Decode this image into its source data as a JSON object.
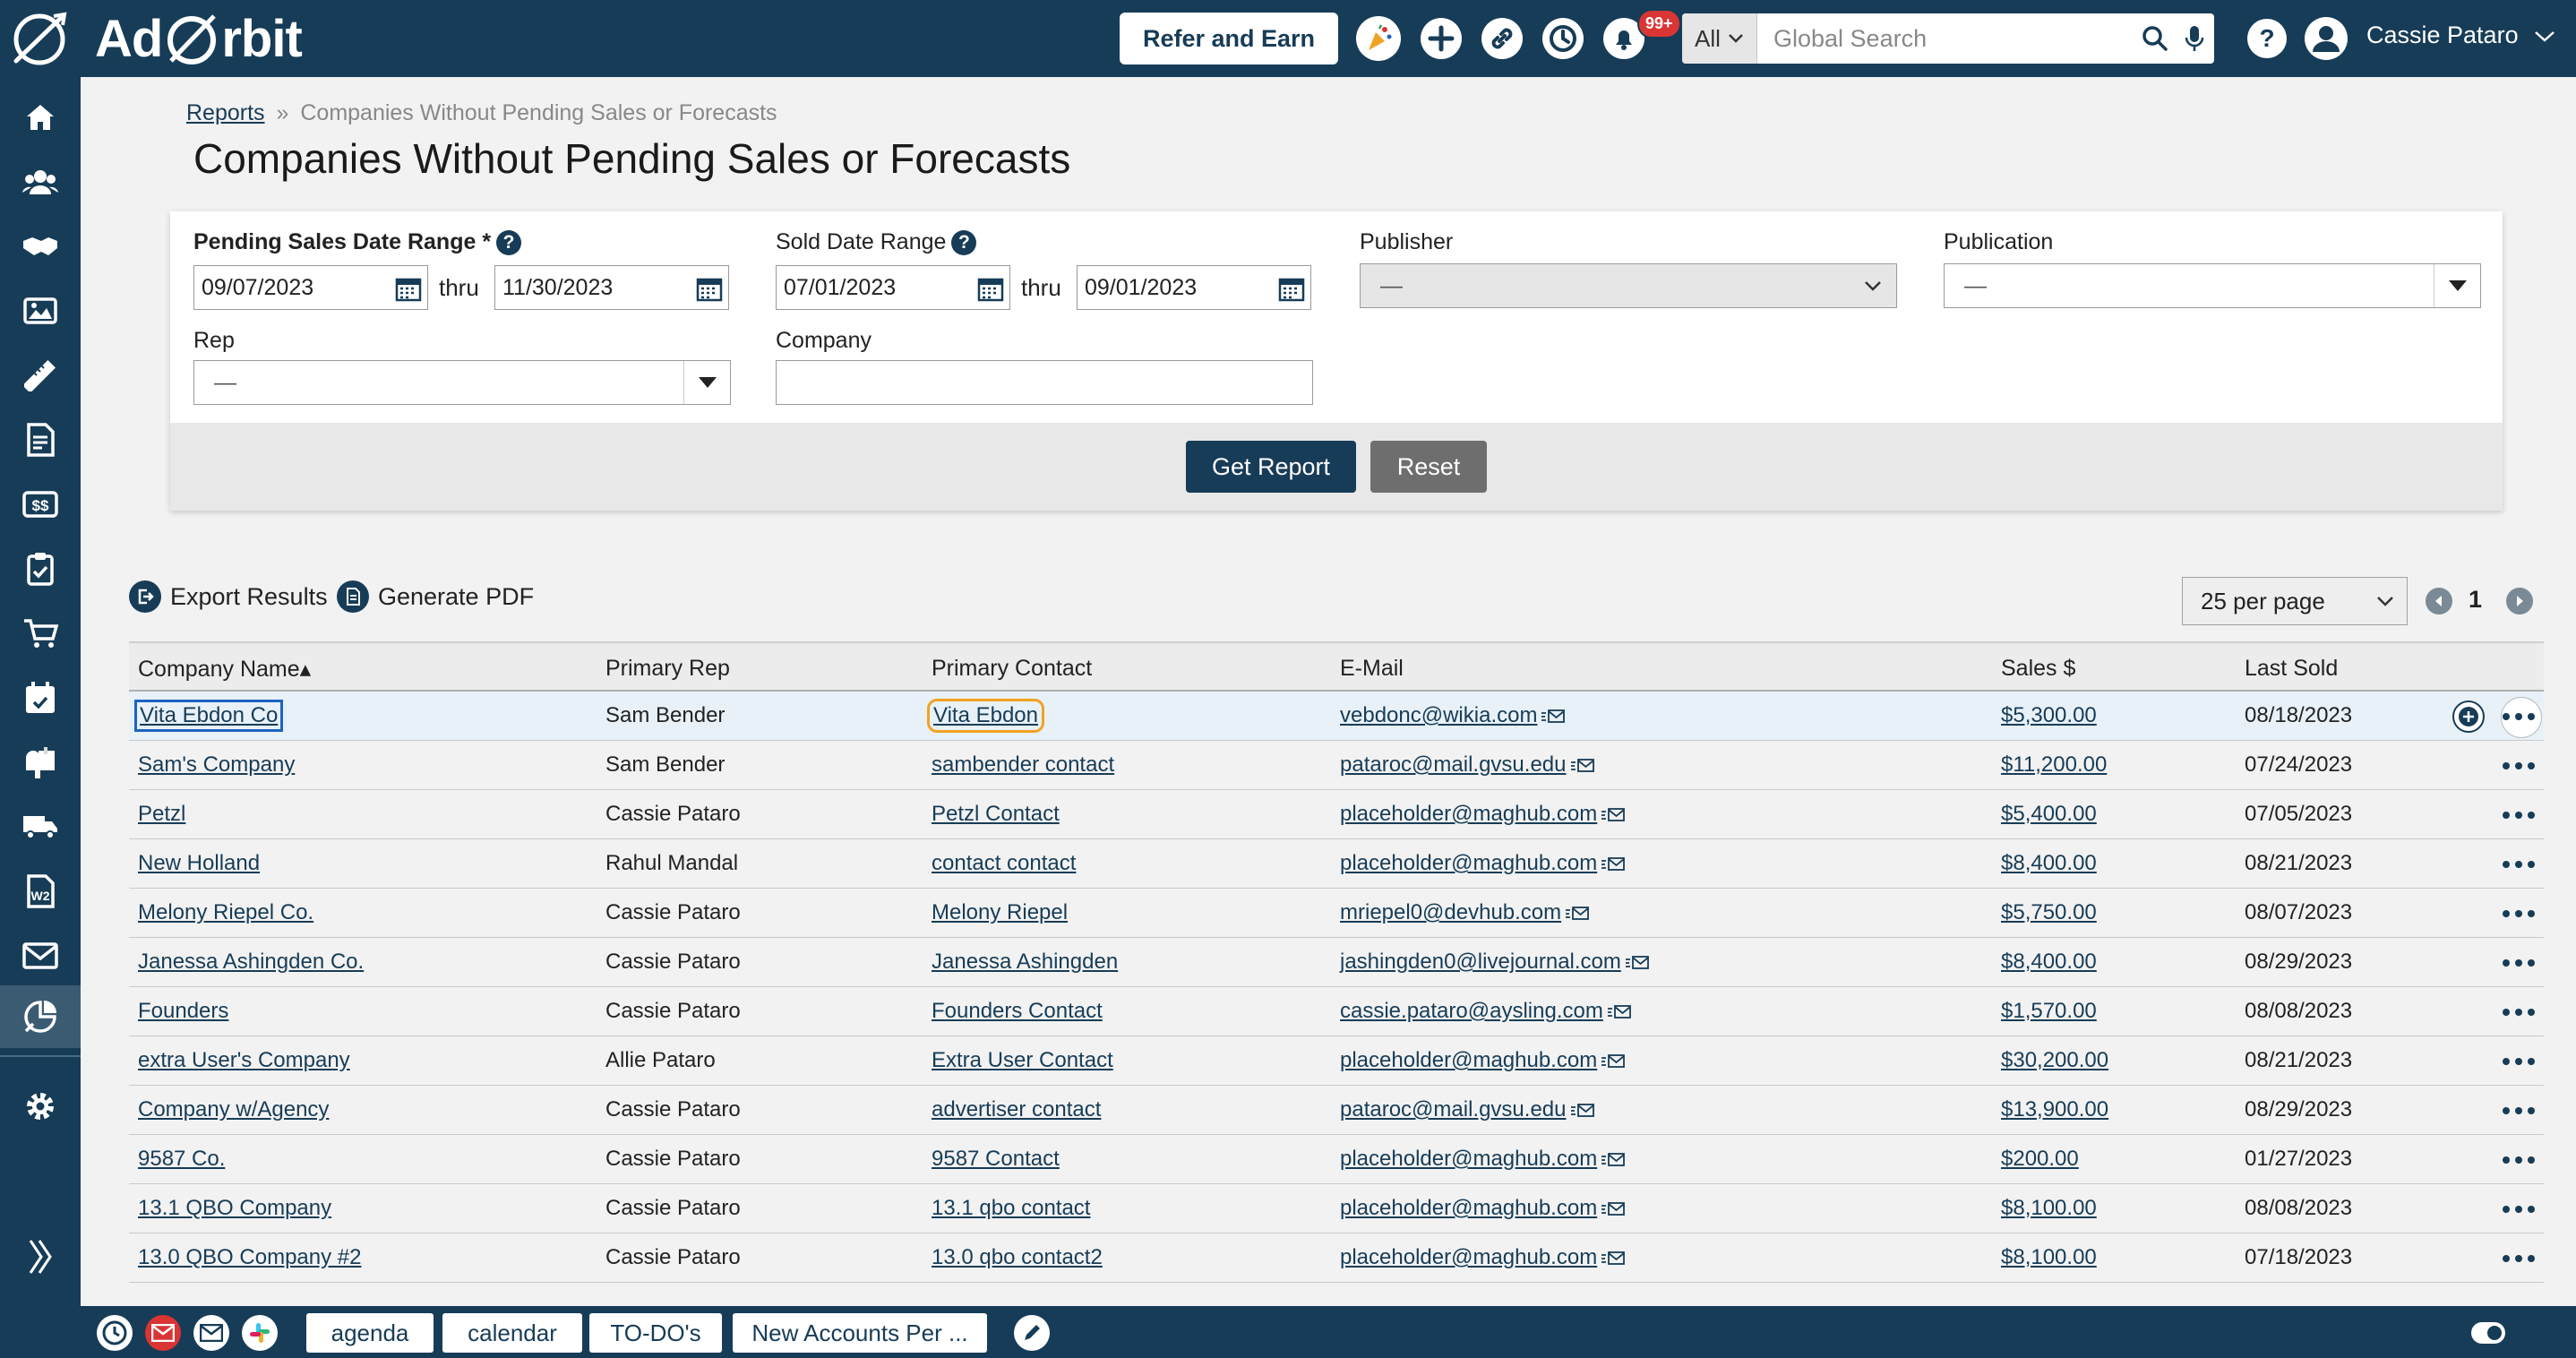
{
  "header": {
    "logo_text_1": "Ad",
    "logo_text_2": "rbit",
    "refer_label": "Refer and Earn",
    "notif_badge": "99+",
    "search_scope": "All",
    "search_placeholder": "Global Search",
    "user_name": "Cassie Pataro"
  },
  "breadcrumb": {
    "parent": "Reports",
    "sep": "»",
    "current": "Companies Without Pending Sales or Forecasts"
  },
  "page_title": "Companies Without Pending Sales or Forecasts",
  "filters": {
    "pending_label": "Pending Sales Date Range *",
    "pending_from": "09/07/2023",
    "pending_to": "11/30/2023",
    "thru": "thru",
    "sold_label": "Sold Date Range",
    "sold_from": "07/01/2023",
    "sold_to": "09/01/2023",
    "publisher_label": "Publisher",
    "publisher_value": "—",
    "publication_label": "Publication",
    "publication_value": "—",
    "rep_label": "Rep",
    "rep_value": "—",
    "company_label": "Company",
    "company_value": "",
    "get_report": "Get Report",
    "reset": "Reset"
  },
  "actions": {
    "export": "Export Results",
    "pdf": "Generate PDF",
    "per_page": "25 per page",
    "page": "1"
  },
  "table": {
    "headers": [
      "Company Name▴",
      "Primary Rep",
      "Primary Contact",
      "E-Mail",
      "Sales $",
      "Last Sold"
    ],
    "rows": [
      {
        "company": "Vita Ebdon Co",
        "rep": "Sam Bender",
        "contact": "Vita Ebdon",
        "email": "vebdonc@wikia.com",
        "sales": "$5,300.00",
        "last": "08/18/2023"
      },
      {
        "company": "Sam's Company",
        "rep": "Sam Bender",
        "contact": "sambender contact",
        "email": "pataroc@mail.gvsu.edu",
        "sales": "$11,200.00",
        "last": "07/24/2023"
      },
      {
        "company": "Petzl",
        "rep": "Cassie Pataro",
        "contact": "Petzl Contact",
        "email": "placeholder@maghub.com",
        "sales": "$5,400.00",
        "last": "07/05/2023"
      },
      {
        "company": "New Holland",
        "rep": "Rahul Mandal",
        "contact": "contact contact",
        "email": "placeholder@maghub.com",
        "sales": "$8,400.00",
        "last": "08/21/2023"
      },
      {
        "company": "Melony Riepel Co.",
        "rep": "Cassie Pataro",
        "contact": "Melony Riepel",
        "email": "mriepel0@devhub.com",
        "sales": "$5,750.00",
        "last": "08/07/2023"
      },
      {
        "company": "Janessa Ashingden Co.",
        "rep": "Cassie Pataro",
        "contact": "Janessa Ashingden",
        "email": "jashingden0@livejournal.com",
        "sales": "$8,400.00",
        "last": "08/29/2023"
      },
      {
        "company": "Founders",
        "rep": "Cassie Pataro",
        "contact": "Founders Contact",
        "email": "cassie.pataro@aysling.com",
        "sales": "$1,570.00",
        "last": "08/08/2023"
      },
      {
        "company": "extra User's Company",
        "rep": "Allie Pataro",
        "contact": "Extra User Contact",
        "email": "placeholder@maghub.com",
        "sales": "$30,200.00",
        "last": "08/21/2023"
      },
      {
        "company": "Company w/Agency",
        "rep": "Cassie Pataro",
        "contact": "advertiser contact",
        "email": "pataroc@mail.gvsu.edu",
        "sales": "$13,900.00",
        "last": "08/29/2023"
      },
      {
        "company": "9587 Co.",
        "rep": "Cassie Pataro",
        "contact": "9587 Contact",
        "email": "placeholder@maghub.com",
        "sales": "$200.00",
        "last": "01/27/2023"
      },
      {
        "company": "13.1 QBO Company",
        "rep": "Cassie Pataro",
        "contact": "13.1 qbo contact",
        "email": "placeholder@maghub.com",
        "sales": "$8,100.00",
        "last": "08/08/2023"
      },
      {
        "company": "13.0 QBO Company #2",
        "rep": "Cassie Pataro",
        "contact": "13.0 qbo contact2",
        "email": "placeholder@maghub.com",
        "sales": "$8,100.00",
        "last": "07/18/2023"
      }
    ]
  },
  "bottom_tabs": [
    "agenda",
    "calendar",
    "TO-DO's",
    "New Accounts Per ..."
  ],
  "colors": {
    "navy": "#173c57",
    "focus_blue": "#1e62c2",
    "focus_orange": "#f0a323",
    "badge_red": "#d93535"
  }
}
